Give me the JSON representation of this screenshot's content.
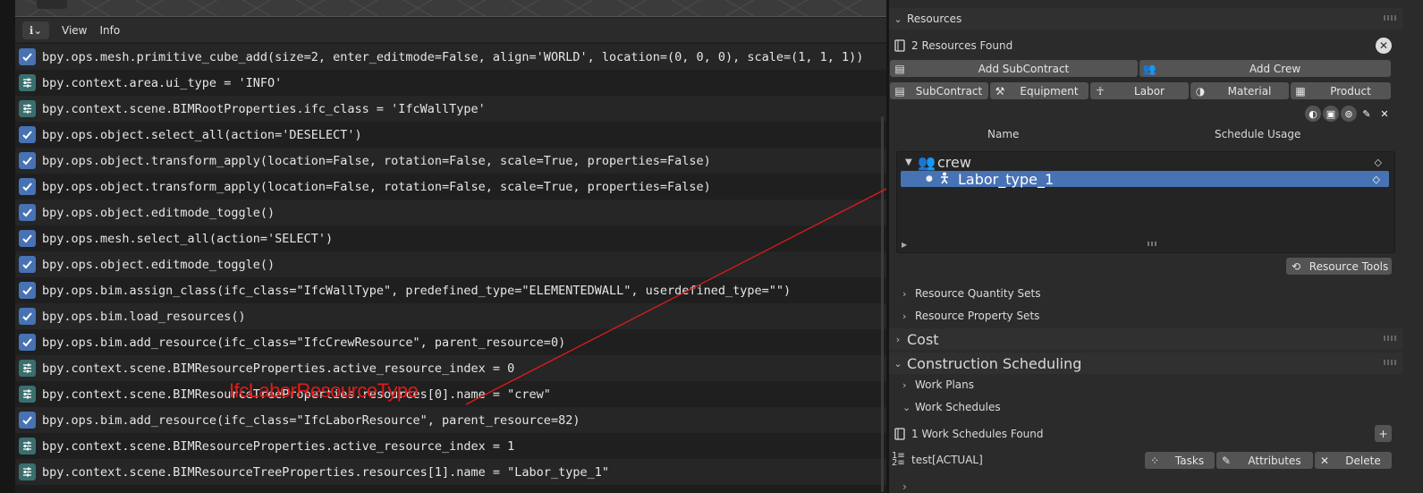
{
  "info_editor": {
    "menus": [
      "View",
      "Info"
    ],
    "entries": [
      {
        "kind": "op",
        "text": "bpy.ops.mesh.primitive_cube_add(size=2, enter_editmode=False, align='WORLD', location=(0, 0, 0), scale=(1, 1, 1))"
      },
      {
        "kind": "prop",
        "text": "bpy.context.area.ui_type = 'INFO'"
      },
      {
        "kind": "prop",
        "text": "bpy.context.scene.BIMRootProperties.ifc_class = 'IfcWallType'"
      },
      {
        "kind": "op",
        "text": "bpy.ops.object.select_all(action='DESELECT')"
      },
      {
        "kind": "op",
        "text": "bpy.ops.object.transform_apply(location=False, rotation=False, scale=True, properties=False)"
      },
      {
        "kind": "op",
        "text": "bpy.ops.object.transform_apply(location=False, rotation=False, scale=True, properties=False)"
      },
      {
        "kind": "op",
        "text": "bpy.ops.object.editmode_toggle()"
      },
      {
        "kind": "op",
        "text": "bpy.ops.mesh.select_all(action='SELECT')"
      },
      {
        "kind": "op",
        "text": "bpy.ops.object.editmode_toggle()"
      },
      {
        "kind": "op",
        "text": "bpy.ops.bim.assign_class(ifc_class=\"IfcWallType\", predefined_type=\"ELEMENTEDWALL\", userdefined_type=\"\")"
      },
      {
        "kind": "op",
        "text": "bpy.ops.bim.load_resources()"
      },
      {
        "kind": "op",
        "text": "bpy.ops.bim.add_resource(ifc_class=\"IfcCrewResource\", parent_resource=0)"
      },
      {
        "kind": "prop",
        "text": "bpy.context.scene.BIMResourceProperties.active_resource_index = 0"
      },
      {
        "kind": "prop",
        "text": "bpy.context.scene.BIMResourceTreeProperties.resources[0].name = \"crew\""
      },
      {
        "kind": "op",
        "text": "bpy.ops.bim.add_resource(ifc_class=\"IfcLaborResource\", parent_resource=82)"
      },
      {
        "kind": "prop",
        "text": "bpy.context.scene.BIMResourceProperties.active_resource_index = 1"
      },
      {
        "kind": "prop",
        "text": "bpy.context.scene.BIMResourceTreeProperties.resources[1].name = \"Labor_type_1\""
      }
    ]
  },
  "annotation": {
    "text": "IfcLaborResourceType",
    "color": "#e11b1b"
  },
  "properties": {
    "resources_panel": {
      "title": "Resources",
      "found": "2 Resources Found",
      "add_subcontract": "Add SubContract",
      "add_crew": "Add Crew",
      "type_buttons": [
        "SubContract",
        "Equipment",
        "Labor",
        "Material",
        "Product"
      ],
      "col_name": "Name",
      "col_schedule_usage": "Schedule Usage",
      "tree": [
        {
          "label": "crew",
          "icon": "crew-icon"
        },
        {
          "label": "Labor_type_1",
          "icon": "labor-icon",
          "selected": true
        }
      ],
      "resource_tools": "Resource Tools",
      "subpanels": [
        "Resource Quantity Sets",
        "Resource Property Sets"
      ]
    },
    "cost_panel": {
      "title": "Cost"
    },
    "construction_panel": {
      "title": "Construction Scheduling",
      "subpanels": [
        "Work Plans",
        "Work Schedules"
      ],
      "schedules_found": "1 Work Schedules Found",
      "schedule_name": "test[ACTUAL]",
      "tasks": "Tasks",
      "attributes": "Attributes",
      "delete": "Delete"
    }
  },
  "colors": {
    "selection": "#4772b3",
    "panel": "#2b2b2b",
    "button": "#545454"
  }
}
